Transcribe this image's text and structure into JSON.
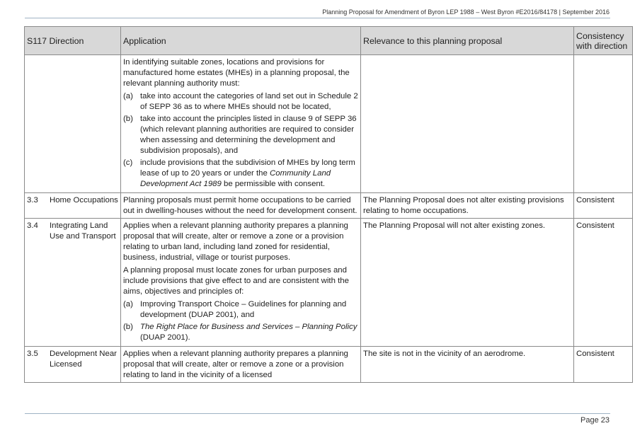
{
  "header": {
    "text": "Planning Proposal for Amendment of Byron LEP 1988 – West Byron #E2016/84178 | September 2016"
  },
  "table": {
    "headers": [
      "S117 Direction",
      "Application",
      "Relevance to this planning proposal",
      "Consistency with direction"
    ],
    "row0": {
      "intro": "In identifying suitable zones, locations and provisions for manufactured home estates (MHEs) in a planning proposal, the relevant planning authority must:",
      "items": [
        {
          "label": "(a)",
          "text": "take into account the categories of land set out in Schedule 2 of SEPP 36 as to where MHEs should not be located,"
        },
        {
          "label": "(b)",
          "text": "take into account the principles listed in clause 9 of SEPP 36 (which relevant planning authorities are required to consider when assessing and determining the development and subdivision proposals), and"
        },
        {
          "label": "(c)",
          "text_a": "include provisions that the subdivision of MHEs by long term lease of up to 20 years or under the ",
          "text_italic": "Community Land Development Act 1989",
          "text_b": " be permissible with consent."
        }
      ]
    },
    "row1": {
      "num": "3.3",
      "name": "Home Occupations",
      "application": "Planning proposals must permit home occupations to be carried out in dwelling-houses without the need for development consent.",
      "relevance": "The Planning Proposal does not alter existing provisions relating to home occupations.",
      "consistency": "Consistent"
    },
    "row2": {
      "num": "3.4",
      "name": "Integrating Land Use and Transport",
      "p1": "Applies when a relevant planning authority prepares a planning proposal that will create, alter or remove a zone or a provision relating to urban land, including land zoned for residential, business, industrial, village or tourist purposes.",
      "p2": "A planning proposal must locate zones for urban purposes and include provisions that give effect to and are consistent with the aims, objectives and principles of:",
      "items": [
        {
          "label": "(a)",
          "text": "Improving Transport Choice – Guidelines for planning and development (DUAP 2001), and"
        },
        {
          "label": "(b)",
          "text_italic": "The Right Place for Business and Services – Planning Policy",
          "text_b": " (DUAP 2001)."
        }
      ],
      "relevance": "The Planning Proposal will not alter existing zones.",
      "consistency": "Consistent"
    },
    "row3": {
      "num": "3.5",
      "name": "Development Near Licensed",
      "application": "Applies when a relevant planning authority prepares a planning proposal that will create, alter or remove a zone or a provision relating to land in the vicinity of a licensed",
      "relevance": "The site is not in the vicinity of an aerodrome.",
      "consistency": "Consistent"
    }
  },
  "footer": {
    "page": "Page 23"
  }
}
